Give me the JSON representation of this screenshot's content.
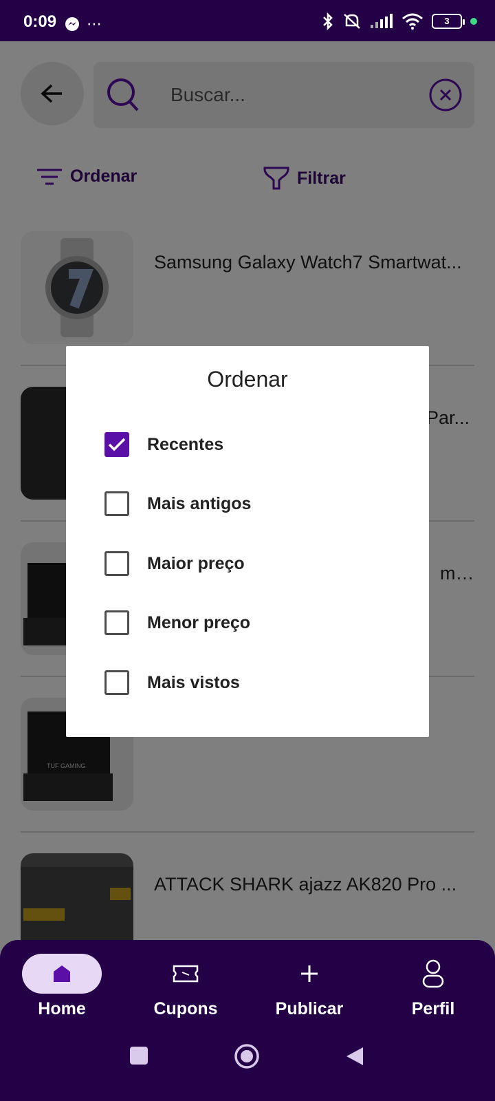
{
  "status_bar": {
    "time": "0:09",
    "more_icon": "⋯",
    "battery": "3",
    "icons": [
      "messenger-icon",
      "bluetooth-icon",
      "mute-icon",
      "signal-icon",
      "wifi-icon",
      "battery-icon"
    ]
  },
  "search": {
    "placeholder": "Buscar..."
  },
  "toolbar": {
    "sort_label": "Ordenar",
    "filter_label": "Filtrar"
  },
  "products": [
    {
      "title": "Samsung Galaxy Watch7 Smartwat..."
    },
    {
      "title": "Par..."
    },
    {
      "title": "mi..."
    },
    {
      "title": ""
    },
    {
      "title": "ATTACK SHARK ajazz AK820 Pro ..."
    }
  ],
  "dialog": {
    "title": "Ordenar",
    "options": [
      {
        "label": "Recentes",
        "checked": true
      },
      {
        "label": "Mais antigos",
        "checked": false
      },
      {
        "label": "Maior preço",
        "checked": false
      },
      {
        "label": "Menor preço",
        "checked": false
      },
      {
        "label": "Mais vistos",
        "checked": false
      }
    ]
  },
  "bottom_nav": {
    "items": [
      {
        "label": "Home",
        "icon": "home-icon",
        "active": true
      },
      {
        "label": "Cupons",
        "icon": "ticket-icon",
        "active": false
      },
      {
        "label": "Publicar",
        "icon": "plus-icon",
        "active": false
      },
      {
        "label": "Perfil",
        "icon": "person-icon",
        "active": false
      }
    ]
  },
  "colors": {
    "brand_dark": "#240046",
    "brand_text": "#3c096c",
    "accent": "#5a0fa6"
  }
}
